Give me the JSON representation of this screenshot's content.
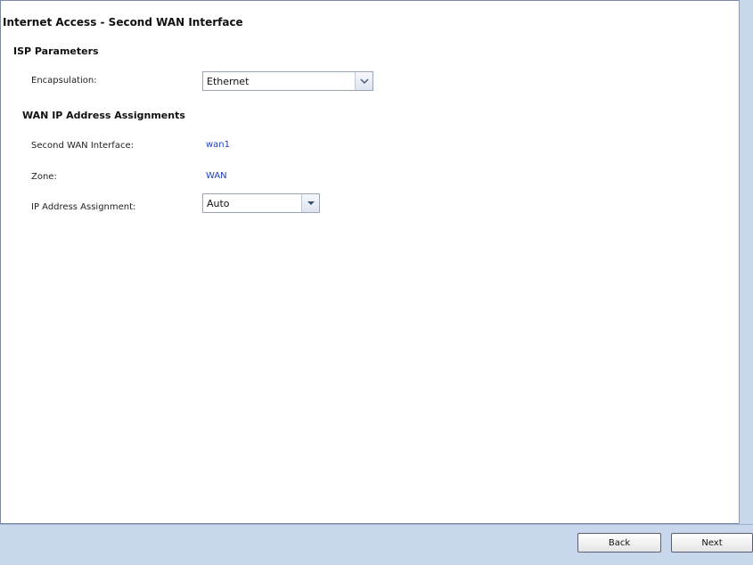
{
  "page": {
    "title": "Internet Access - Second WAN Interface"
  },
  "isp": {
    "section_title": "ISP Parameters",
    "encap_label": "Encapsulation:",
    "encap_value": "Ethernet"
  },
  "wan": {
    "section_title": "WAN IP Address Assignments",
    "second_iface_label": "Second WAN Interface:",
    "second_iface_value": "wan1",
    "zone_label": "Zone:",
    "zone_value": "WAN",
    "ip_assign_label": "IP Address Assignment:",
    "ip_assign_value": "Auto"
  },
  "footer": {
    "back_label": "Back",
    "next_label": "Next"
  },
  "icons": {
    "dropdown": "chevron-down-icon"
  }
}
